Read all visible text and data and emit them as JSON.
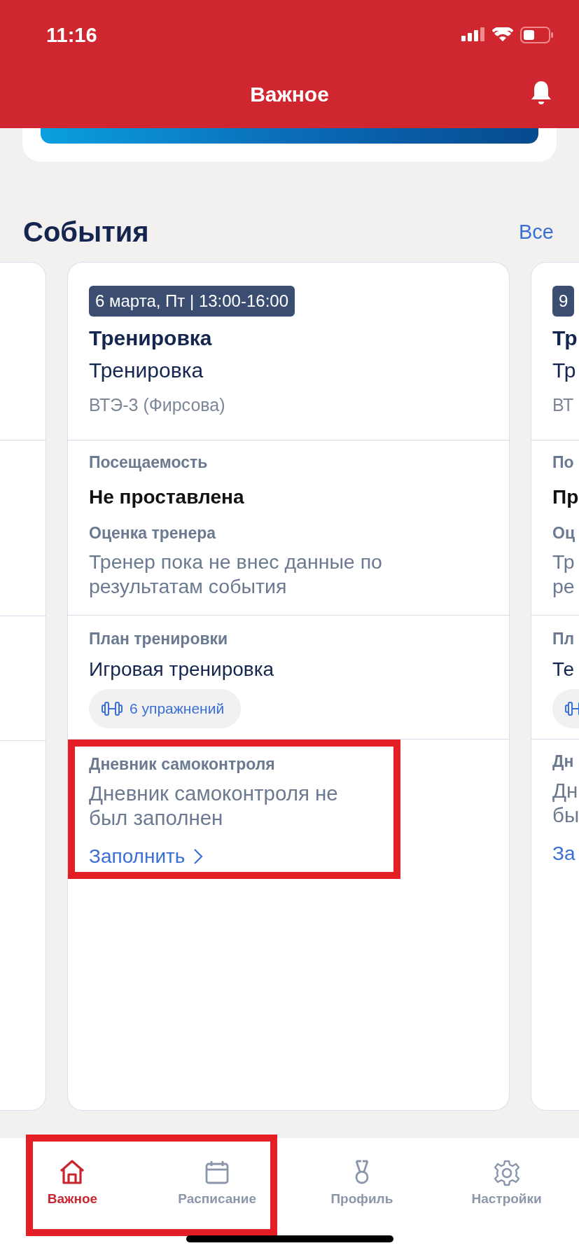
{
  "status_bar": {
    "time": "11:16"
  },
  "header": {
    "title": "Важное"
  },
  "section": {
    "title": "События",
    "link": "Все"
  },
  "events": [
    {
      "kind": "edge"
    },
    {
      "kind": "full",
      "date": "6 марта, Пт | 13:00-16:00",
      "title": "Тренировка",
      "type": "Тренировка",
      "group": "ВТЭ-3 (Фирсова)",
      "attendance_label": "Посещаемость",
      "attendance": "Не проставлена",
      "rating_label": "Оценка тренера",
      "rating_text": "Тренер пока не внес данные по результатам события",
      "plan_label": "План тренировки",
      "plan": "Игровая тренировка",
      "exercises": "6 упражнений",
      "diary_label": "Дневник самоконтроля",
      "diary_text": "Дневник самоконтроля не был заполнен",
      "diary_action": "Заполнить",
      "highlighted": true
    },
    {
      "kind": "full",
      "date": "9",
      "title": "Тр",
      "type": "Тр",
      "group": "ВТ",
      "attendance_label": "По",
      "attendance": "Пр",
      "rating_label": "Оц",
      "rating_text": "Тр\nре",
      "plan_label": "Пл",
      "plan": "Те",
      "diary_label": "Дн",
      "diary_text": "Дн\nбы",
      "diary_action": "За",
      "highlighted": false
    }
  ],
  "tab_bar": {
    "tabs": [
      {
        "label": "Важное",
        "kind": "home",
        "selected": true,
        "highlighted": true
      },
      {
        "label": "Расписание",
        "kind": "calendar",
        "selected": false,
        "highlighted": true
      },
      {
        "label": "Профиль",
        "kind": "medal",
        "selected": false,
        "highlighted": false
      },
      {
        "label": "Настройки",
        "kind": "gear",
        "selected": false,
        "highlighted": false
      }
    ]
  }
}
